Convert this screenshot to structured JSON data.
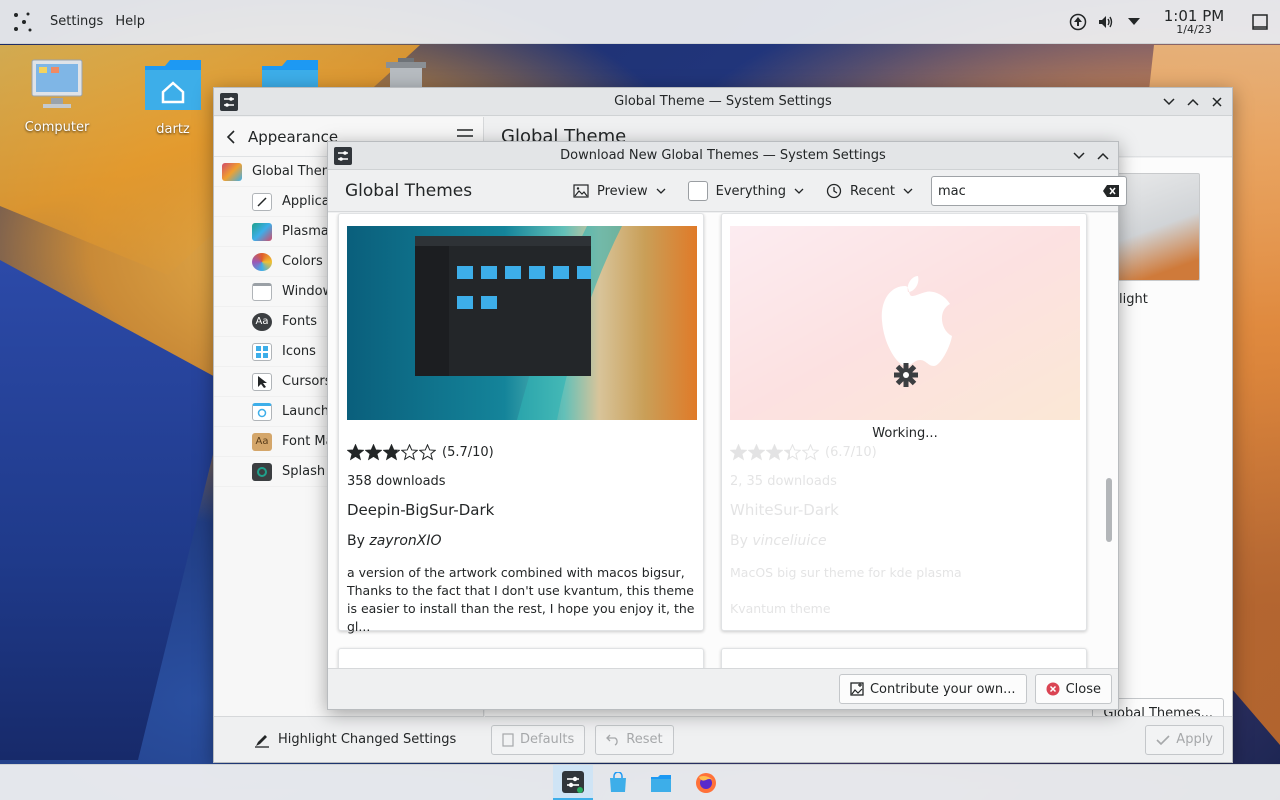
{
  "top_panel": {
    "menus": [
      "Settings",
      "Help"
    ],
    "clock": {
      "time": "1:01 PM",
      "date": "1/4/23"
    }
  },
  "desktop": {
    "icons": [
      {
        "label": "Computer",
        "icon": "computer-icon"
      },
      {
        "label": "dartz",
        "icon": "home-folder-icon"
      },
      {
        "label": "",
        "icon": "folder-icon"
      },
      {
        "label": "",
        "icon": "trash-icon"
      }
    ]
  },
  "settings_window": {
    "title": "Global Theme — System Settings",
    "sidebar": {
      "back_label": "Appearance",
      "items": [
        {
          "label": "Global Theme",
          "icon": "global-theme-icon",
          "color": "#d14b6a"
        },
        {
          "label": "Application Style",
          "icon": "app-style-icon",
          "color": "#ffffff"
        },
        {
          "label": "Plasma Style",
          "icon": "plasma-style-icon",
          "color": "#1fa18c"
        },
        {
          "label": "Colors",
          "icon": "colors-icon",
          "color": "#e05b2a"
        },
        {
          "label": "Window Decorations",
          "icon": "window-deco-icon",
          "color": "#ffffff"
        },
        {
          "label": "Fonts",
          "icon": "fonts-icon",
          "color": "#3b3e41"
        },
        {
          "label": "Icons",
          "icon": "icons-icon",
          "color": "#3daee9"
        },
        {
          "label": "Cursors",
          "icon": "cursors-icon",
          "color": "#ffffff"
        },
        {
          "label": "Launch Feedback",
          "icon": "launch-feedback-icon",
          "color": "#3daee9"
        },
        {
          "label": "Font Management",
          "icon": "font-management-icon",
          "color": "#d4a66a"
        },
        {
          "label": "Splash Screen",
          "icon": "splash-screen-icon",
          "color": "#1fa18c"
        }
      ],
      "highlight_label": "Highlight Changed Settings"
    },
    "main_title": "Global Theme",
    "preview_label": "light",
    "buttons": {
      "defaults": "Defaults",
      "reset": "Reset",
      "apply": "Apply",
      "get_new": "Global Themes..."
    }
  },
  "download_dialog": {
    "title": "Download New Global Themes — System Settings",
    "heading": "Global Themes",
    "toolbar": {
      "view": "Preview",
      "filter": "Everything",
      "sort": "Recent",
      "search_value": "mac"
    },
    "cards": [
      {
        "rating_value": 5.7,
        "rating": "(5.7/10)",
        "downloads": "358 downloads",
        "name": "Deepin-BigSur-Dark",
        "by": "By ",
        "author": "zayronXIO",
        "description": "a version of the artwork combined with macos bigsur, Thanks to the fact that I don't use kvantum, this theme is easier to install than the rest, I hope you enjoy it, the gl..."
      },
      {
        "status": "Working...",
        "rating_value": 6.7,
        "rating": "(6.7/10)",
        "downloads": "2, 35 downloads",
        "name": "WhiteSur-Dark",
        "by": "By ",
        "author": "vinceliuice",
        "description": "MacOS big sur theme for kde plasma",
        "description2": "Kvantum theme"
      }
    ],
    "footer": {
      "contribute": "Contribute your own...",
      "close": "Close"
    }
  }
}
